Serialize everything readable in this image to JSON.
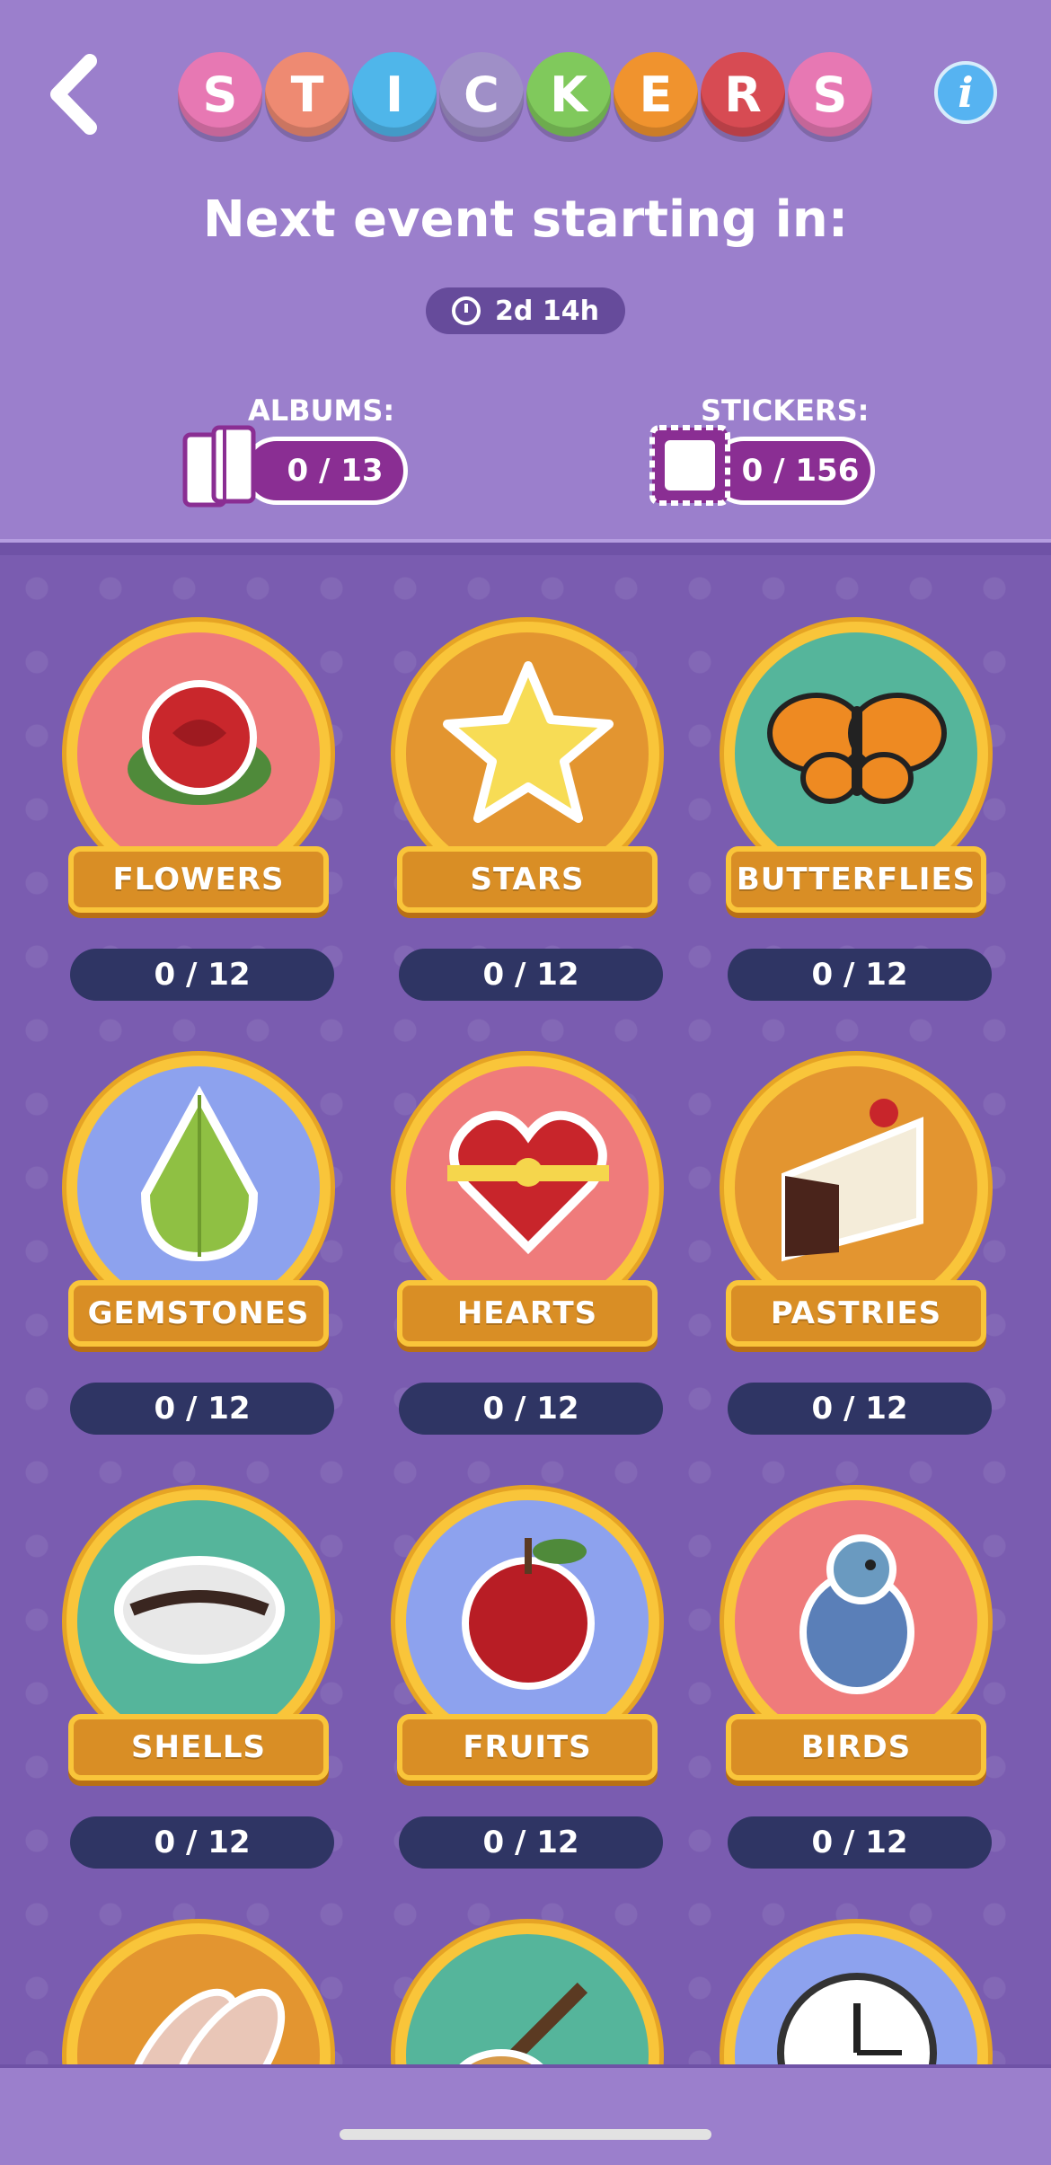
{
  "header": {
    "title_letters": [
      {
        "char": "S",
        "color": "#e778b3"
      },
      {
        "char": "T",
        "color": "#ee8a72"
      },
      {
        "char": "I",
        "color": "#4fb6ea"
      },
      {
        "char": "C",
        "color": "#9f8fc7"
      },
      {
        "char": "K",
        "color": "#80c95c"
      },
      {
        "char": "E",
        "color": "#f0932e"
      },
      {
        "char": "R",
        "color": "#d74b53"
      },
      {
        "char": "S",
        "color": "#e778b3"
      }
    ],
    "back_icon": "chevron-left-icon",
    "info_icon": "info-icon",
    "info_glyph": "i",
    "next_event_text": "Next event starting in:",
    "timer": "2d 14h"
  },
  "counters": {
    "albums_label": "ALBUMS:",
    "albums_value": "0 / 13",
    "stickers_label": "STICKERS:",
    "stickers_value": "0 / 156"
  },
  "albums": [
    {
      "label": "FLOWERS",
      "progress": "0 / 12",
      "bg": "#ef7b7b",
      "icon": "rose-icon"
    },
    {
      "label": "STARS",
      "progress": "0 / 12",
      "bg": "#e39530",
      "icon": "star-icon"
    },
    {
      "label": "BUTTERFLIES",
      "progress": "0 / 12",
      "bg": "#55b59b",
      "icon": "butterfly-icon"
    },
    {
      "label": "GEMSTONES",
      "progress": "0 / 12",
      "bg": "#8da2ee",
      "icon": "gemstone-icon"
    },
    {
      "label": "HEARTS",
      "progress": "0 / 12",
      "bg": "#ef7b7b",
      "icon": "heart-icon"
    },
    {
      "label": "PASTRIES",
      "progress": "0 / 12",
      "bg": "#e39530",
      "icon": "cake-icon"
    },
    {
      "label": "SHELLS",
      "progress": "0 / 12",
      "bg": "#55b59b",
      "icon": "shell-icon"
    },
    {
      "label": "FRUITS",
      "progress": "0 / 12",
      "bg": "#8da2ee",
      "icon": "apple-icon"
    },
    {
      "label": "BIRDS",
      "progress": "0 / 12",
      "bg": "#ef7b7b",
      "icon": "bird-icon"
    },
    {
      "label": "",
      "progress": "",
      "bg": "#e39530",
      "icon": "ballet-shoes-icon"
    },
    {
      "label": "",
      "progress": "",
      "bg": "#55b59b",
      "icon": "guitar-icon"
    },
    {
      "label": "",
      "progress": "",
      "bg": "#8da2ee",
      "icon": "clock-icon"
    }
  ]
}
